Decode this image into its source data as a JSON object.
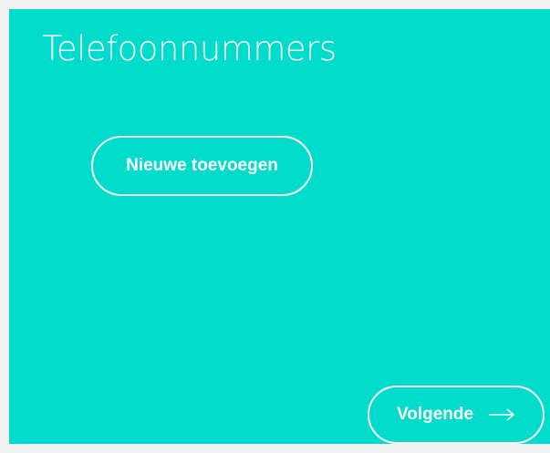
{
  "page": {
    "title": "Telefoonnummers"
  },
  "actions": {
    "add_label": "Nieuwe toevoegen",
    "next_label": "Volgende"
  },
  "icons": {
    "next_arrow": "arrow-right-icon"
  },
  "colors": {
    "background": "#00dccb",
    "outer": "#f2f2f2",
    "text": "#ffffff"
  }
}
